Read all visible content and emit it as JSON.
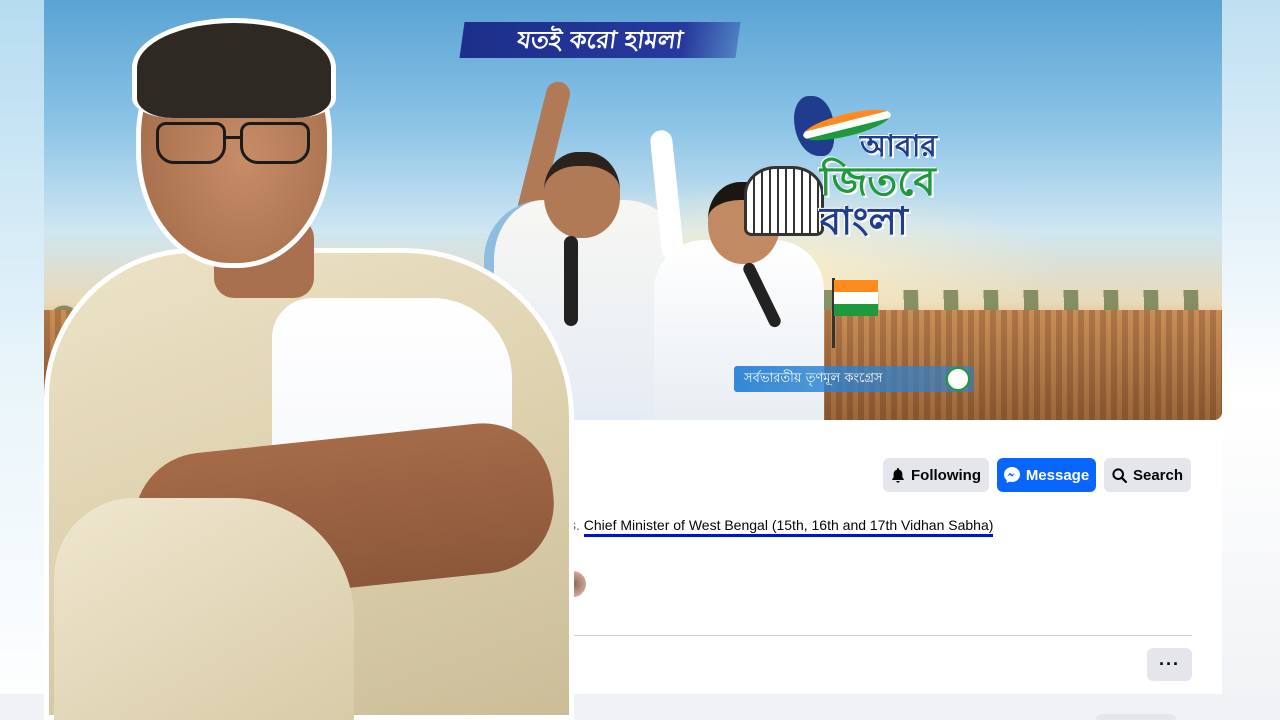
{
  "cover": {
    "banner_text": "যতই করো হামলা",
    "campaign_logo": {
      "line1": "আবার",
      "line2": "জিতবে",
      "line3": "বাংলা"
    },
    "party_name": "সর্বভারতীয় তৃণমূল কংগ্রেস"
  },
  "actions": {
    "following_label": "Following",
    "message_label": "Message",
    "search_label": "Search",
    "more_label": "···"
  },
  "intro": {
    "prefix": "ss.",
    "role": "Chief Minister of West Bengal (15th, 16th and 17th Vidhan Sabha)"
  },
  "colors": {
    "primary_blue": "#0866ff",
    "secondary_button": "#e4e6eb",
    "underline_annotation": "#0012d6",
    "page_background": "#f0f2f5"
  },
  "icons": {
    "following": "bell-icon",
    "message": "messenger-icon",
    "search": "search-icon",
    "more": "more-dots-icon"
  }
}
